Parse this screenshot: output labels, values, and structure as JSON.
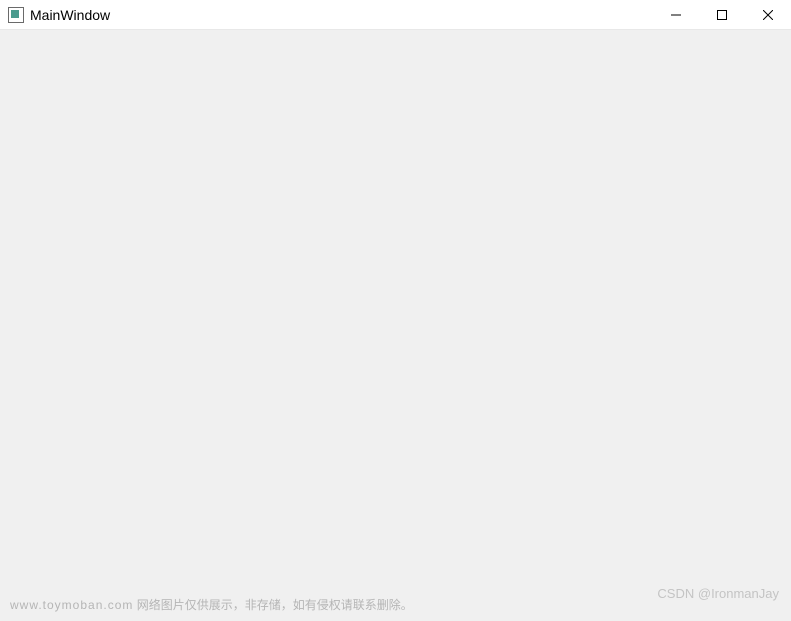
{
  "window": {
    "title": "MainWindow"
  },
  "watermark": {
    "left_domain": "www.toymoban.com",
    "left_text": "网络图片仅供展示，非存储，如有侵权请联系删除。",
    "right": "CSDN @IronmanJay"
  }
}
